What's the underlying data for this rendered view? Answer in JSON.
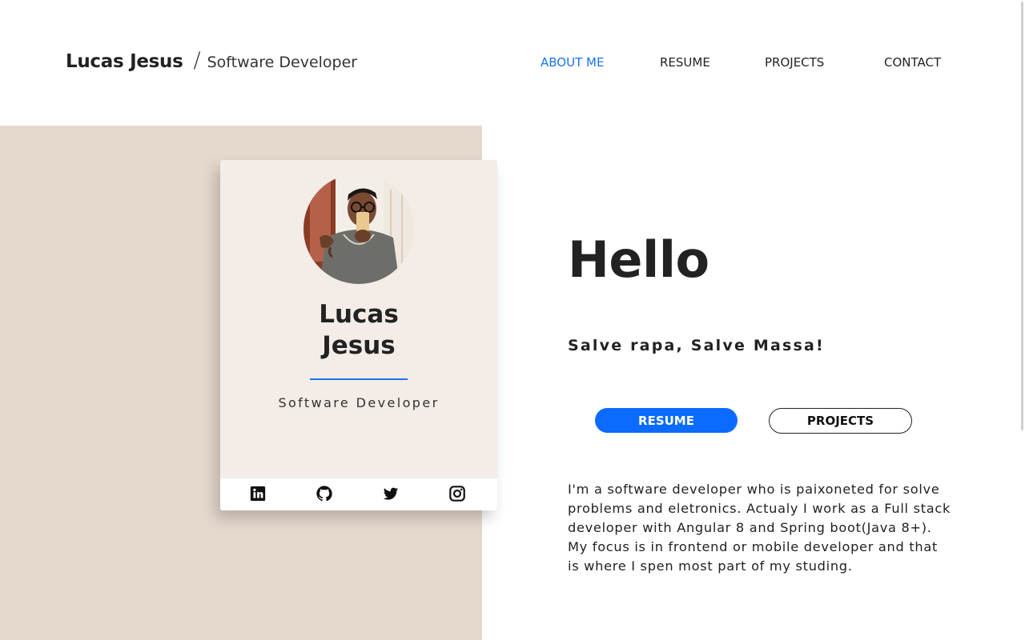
{
  "header": {
    "name": "Lucas Jesus",
    "separator": "/",
    "role": "Software Developer"
  },
  "nav": {
    "items": [
      {
        "label": "ABOUT ME",
        "active": true
      },
      {
        "label": "RESUME",
        "active": false
      },
      {
        "label": "PROJECTS",
        "active": false
      },
      {
        "label": "CONTACT",
        "active": false
      }
    ]
  },
  "card": {
    "name": "Lucas\nJesus",
    "role": "Software Developer",
    "social_icons": [
      "linkedin-icon",
      "github-icon",
      "twitter-icon",
      "instagram-icon"
    ]
  },
  "main": {
    "greeting": "Hello",
    "tagline": "Salve rapa, Salve Massa!",
    "resume_button": "RESUME",
    "projects_button": "PROJECTS",
    "bio": "I'm a software developer who is paixoneted for solve\nproblems and eletronics. Actualy I work as a Full stack\ndeveloper with Angular 8 and Spring boot(Java 8+).\nMy focus is in frontend or mobile developer and that\nis where I spen most part of my studing."
  },
  "colors": {
    "accent": "#1a73e8",
    "primary_button": "#0b6bff",
    "panel": "#e5d9ce",
    "card": "#f3ece7",
    "text": "#222222"
  }
}
